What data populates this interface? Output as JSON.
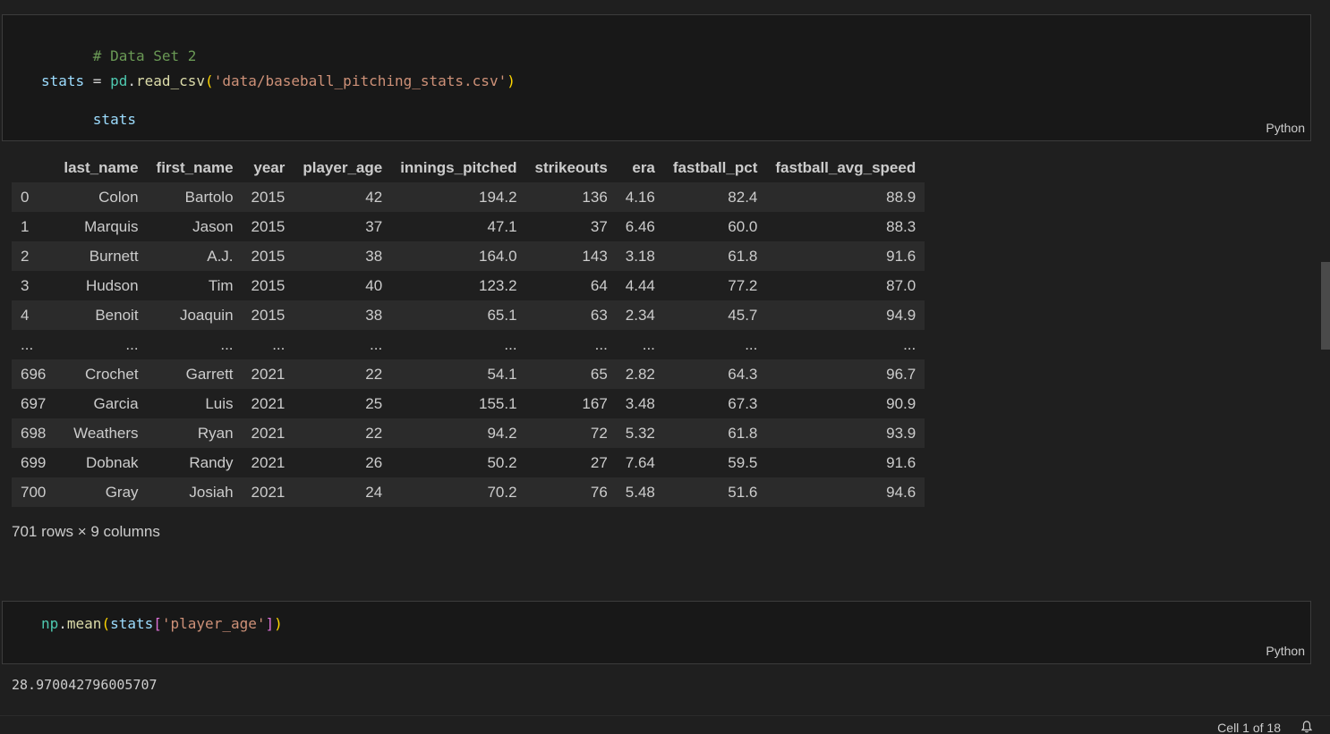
{
  "cell1": {
    "comment": "# Data Set 2",
    "line2": {
      "var": "stats",
      "op": " = ",
      "mod": "pd",
      "dot": ".",
      "func": "read_csv",
      "open": "(",
      "str": "'data/baseball_pitching_stats.csv'",
      "close": ")"
    },
    "line3": "stats",
    "language": "Python"
  },
  "dataframe": {
    "columns": [
      "",
      "last_name",
      "first_name",
      "year",
      "player_age",
      "innings_pitched",
      "strikeouts",
      "era",
      "fastball_pct",
      "fastball_avg_speed"
    ],
    "rows": [
      [
        "0",
        "Colon",
        "Bartolo",
        "2015",
        "42",
        "194.2",
        "136",
        "4.16",
        "82.4",
        "88.9"
      ],
      [
        "1",
        "Marquis",
        "Jason",
        "2015",
        "37",
        "47.1",
        "37",
        "6.46",
        "60.0",
        "88.3"
      ],
      [
        "2",
        "Burnett",
        "A.J.",
        "2015",
        "38",
        "164.0",
        "143",
        "3.18",
        "61.8",
        "91.6"
      ],
      [
        "3",
        "Hudson",
        "Tim",
        "2015",
        "40",
        "123.2",
        "64",
        "4.44",
        "77.2",
        "87.0"
      ],
      [
        "4",
        "Benoit",
        "Joaquin",
        "2015",
        "38",
        "65.1",
        "63",
        "2.34",
        "45.7",
        "94.9"
      ],
      [
        "...",
        "...",
        "...",
        "...",
        "...",
        "...",
        "...",
        "...",
        "...",
        "..."
      ],
      [
        "696",
        "Crochet",
        "Garrett",
        "2021",
        "22",
        "54.1",
        "65",
        "2.82",
        "64.3",
        "96.7"
      ],
      [
        "697",
        "Garcia",
        "Luis",
        "2021",
        "25",
        "155.1",
        "167",
        "3.48",
        "67.3",
        "90.9"
      ],
      [
        "698",
        "Weathers",
        "Ryan",
        "2021",
        "22",
        "94.2",
        "72",
        "5.32",
        "61.8",
        "93.9"
      ],
      [
        "699",
        "Dobnak",
        "Randy",
        "2021",
        "26",
        "50.2",
        "27",
        "7.64",
        "59.5",
        "91.6"
      ],
      [
        "700",
        "Gray",
        "Josiah",
        "2021",
        "24",
        "70.2",
        "76",
        "5.48",
        "51.6",
        "94.6"
      ]
    ],
    "shape": "701 rows × 9 columns"
  },
  "cell2": {
    "mod": "np",
    "dot": ".",
    "func": "mean",
    "open": "(",
    "var": "stats",
    "bopen": "[",
    "str": "'player_age'",
    "bclose": "]",
    "close": ")",
    "language": "Python",
    "output": "28.970042796005707"
  },
  "status_bar": {
    "cell_indicator": "Cell 1 of 18"
  }
}
